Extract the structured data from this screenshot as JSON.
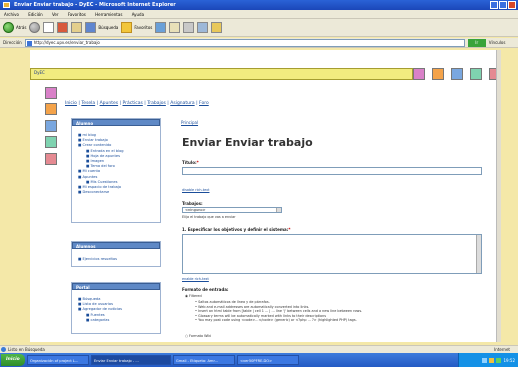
{
  "window": {
    "title": "Enviar Enviar trabajo - DyEC - Microsoft Internet Explorer"
  },
  "menubar": [
    "Archivo",
    "Edición",
    "Ver",
    "Favoritos",
    "Herramientas",
    "Ayuda"
  ],
  "toolbar": {
    "back": "Atrás",
    "search": "Búsqueda",
    "favorites": "Favoritos"
  },
  "address": {
    "label": "Dirección",
    "url": "http://dyec.upv.es/enviar_trabajo",
    "go": "Ir",
    "links": "Vínculos"
  },
  "site": {
    "strip_label": "DyEC",
    "colors": [
      "#d981c8",
      "#f4a34a",
      "#7aa7df",
      "#7fd3b0",
      "#e58a92"
    ]
  },
  "nav": [
    "Inicio",
    "Tesela",
    "Apuntes",
    "Prácticas",
    "Trabajos",
    "Asignatura",
    "Foro"
  ],
  "sidebar": {
    "box1": {
      "title": "Alumno",
      "items": [
        {
          "label": "mi blog",
          "level": 1
        },
        {
          "label": "Enviar trabajo",
          "level": 1
        },
        {
          "label": "Crear contenido",
          "level": 1
        },
        {
          "label": "Entrada en el blog",
          "level": 2
        },
        {
          "label": "Hoja de apuntes",
          "level": 2
        },
        {
          "label": "Imagen",
          "level": 2
        },
        {
          "label": "Tema del foro",
          "level": 2
        },
        {
          "label": "Mi cuenta",
          "level": 1
        },
        {
          "label": "Apuntes",
          "level": 1
        },
        {
          "label": "Mis Cuestiones",
          "level": 2
        },
        {
          "label": "Mi espacio de trabajo",
          "level": 1
        },
        {
          "label": "Desconectarse",
          "level": 1
        }
      ]
    },
    "box2": {
      "title": "Alumnos",
      "items": [
        {
          "label": "Ejercicios resueltos",
          "level": 1
        }
      ]
    },
    "box3": {
      "title": "Portal",
      "items": [
        {
          "label": "Búsqueda",
          "level": 1
        },
        {
          "label": "Lista de usuarios",
          "level": 1
        },
        {
          "label": "Agregador de noticias",
          "level": 1
        },
        {
          "label": "Fuentes",
          "level": 2
        },
        {
          "label": "categorías",
          "level": 2
        }
      ]
    }
  },
  "main": {
    "breadcrumb": "Principal",
    "title": "Enviar Enviar trabajo",
    "title_field": {
      "label": "Título:",
      "required": "*",
      "value": ""
    },
    "disable_link": "disable rich-text",
    "trabajos": {
      "label": "Trabajos:",
      "value": "<ninguno>",
      "help": "Elija el trabajo que vas a enviar"
    },
    "objectives": {
      "label": "1. Especificar los objetivos y definir el sistema:",
      "required": "*"
    },
    "disable_link2": "enable rich-text",
    "input_format": {
      "label": "Formato de entrada:",
      "options": [
        {
          "label": "Filtered",
          "checked": true,
          "notes": [
            "Saltos automáticos de línea y de párrafos.",
            "Web and e-mail addresses are automatically converted into links.",
            "Insert an html table from [table | cell 1 ... | ... line '|' between cells and a new line between rows.",
            "Glossary terms will be automatically marked with links to their descriptions",
            "You may post code using <code>...</code> (generic) or <?php ... ?> (highlighted PHP) tags."
          ]
        },
        {
          "label": "Formato Wiki",
          "checked": false
        }
      ]
    }
  },
  "status": {
    "text": "Listo en Búsqueda",
    "zone": "Internet"
  },
  "taskbar": {
    "start": "Inicio",
    "tasks": [
      "Organización of project L...",
      "Enviar Enviar trabajo - ...",
      "Gmail - Etiqueta: Amr...",
      "<ver50PFRE.DO>"
    ],
    "active_index": 1,
    "clock": "19:52"
  }
}
